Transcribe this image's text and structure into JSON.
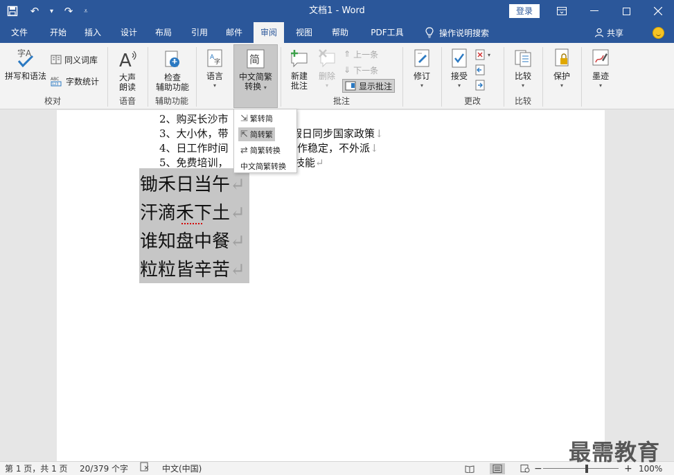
{
  "titlebar": {
    "doc_title": "文档1  -  Word",
    "login_label": "登录"
  },
  "tabs": [
    "文件",
    "开始",
    "插入",
    "设计",
    "布局",
    "引用",
    "邮件",
    "审阅",
    "视图",
    "帮助",
    "PDF工具集"
  ],
  "active_tab": "审阅",
  "tell_me": "操作说明搜索",
  "share_label": "共享",
  "ribbon": {
    "proofing": {
      "spelling": "拼写和语法",
      "thesaurus": "同义词库",
      "wordcount": "字数统计",
      "label": "校对"
    },
    "speech": {
      "read_aloud_1": "大声",
      "read_aloud_2": "朗读",
      "label": "语音"
    },
    "accessibility": {
      "check_1": "检查",
      "check_2": "辅助功能",
      "label": "辅助功能"
    },
    "language": {
      "language_btn": "语言"
    },
    "chinese_conversion": {
      "btn_1": "中文简繁",
      "btn_2": "转换"
    },
    "comments": {
      "new_1": "新建",
      "new_2": "批注",
      "delete": "删除",
      "prev": "上一条",
      "next": "下一条",
      "show": "显示批注",
      "label": "批注"
    },
    "tracking": {
      "track": "修订"
    },
    "changes": {
      "accept": "接受",
      "label": "更改"
    },
    "compare": {
      "compare": "比较",
      "label": "比较"
    },
    "protect": {
      "protect": "保护"
    },
    "ink": {
      "ink": "墨迹"
    }
  },
  "dropdown": {
    "items": [
      "繁转简",
      "简转繁",
      "简繁转换"
    ],
    "footer": "中文简繁转换"
  },
  "document": {
    "list_lines": [
      "2、购买长沙市",
      "3、大小休，带",
      "4、日工作时间",
      "5、免费培训，"
    ],
    "list_tails": [
      "",
      "假日同步国家政策",
      "作稳定，不外派",
      "技能"
    ],
    "poem": [
      "锄禾日当午",
      "汗滴禾下土",
      "谁知盘中餐",
      "粒粒皆辛苦"
    ],
    "pilcrow": "↵",
    "line_break": "↓"
  },
  "status": {
    "page": "第 1 页，共 1 页",
    "words": "20/379 个字",
    "language": "中文(中国)",
    "zoom": "100%"
  },
  "watermark": "最需教育",
  "colors": {
    "accent": "#2b579a",
    "ribbon_bg": "#f3f3f3"
  }
}
